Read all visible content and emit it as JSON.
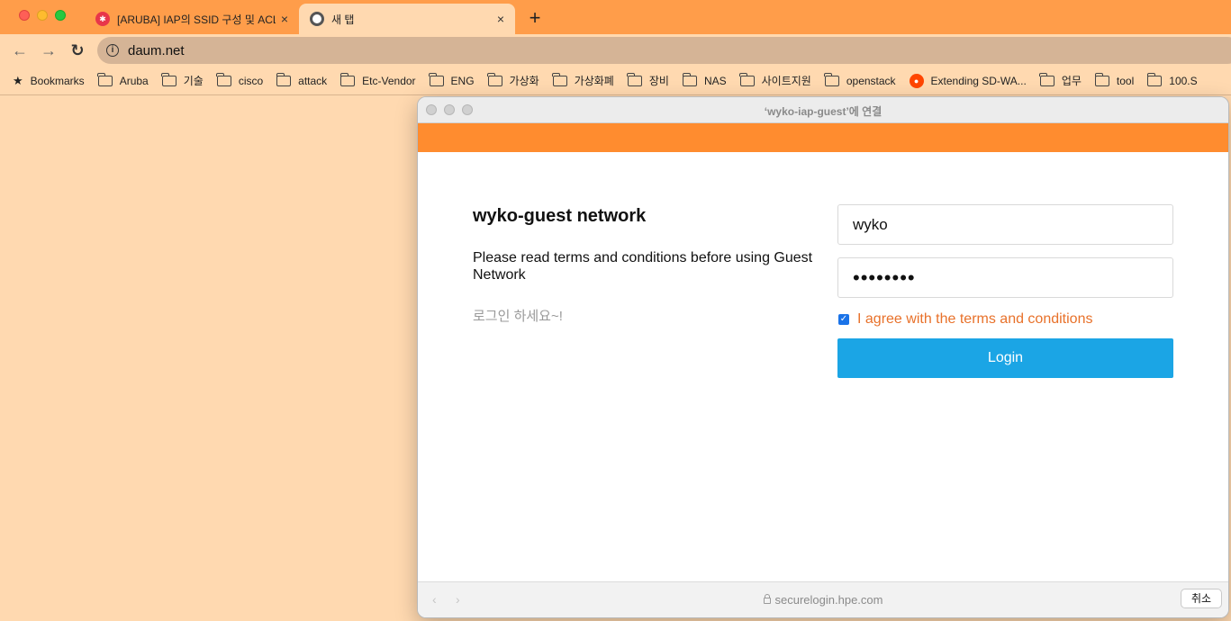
{
  "browser": {
    "tabs": [
      {
        "title": "[ARUBA] IAP의 SSID 구성 및 ACL",
        "close": "×"
      },
      {
        "title": "새 탭",
        "close": "×"
      }
    ],
    "new_tab": "+",
    "nav": {
      "back": "←",
      "forward": "→",
      "reload": "↻"
    },
    "address": {
      "info": "i",
      "url": "daum.net"
    },
    "bookmarks": [
      "Bookmarks",
      "Aruba",
      "기술",
      "cisco",
      "attack",
      "Etc-Vendor",
      "ENG",
      "가상화",
      "가상화폐",
      "장비",
      "NAS",
      "사이트지원",
      "openstack",
      "Extending SD-WA...",
      "업무",
      "tool",
      "100.S"
    ]
  },
  "portal": {
    "window_title": "‘wyko-iap-guest’에 연결",
    "heading": "wyko-guest network",
    "terms_text": "Please read terms and conditions before using Guest Network",
    "korean_note": "로그인 하세요~!",
    "username_value": "wyko",
    "password_value": "••••••••",
    "agree_checked": "✓",
    "agree_label": "I agree with the terms and conditions",
    "login_label": "Login",
    "footer": {
      "back": "‹",
      "forward": "›",
      "host": "securelogin.hpe.com",
      "cancel": "취소"
    }
  },
  "colors": {
    "tabstrip": "#ff9d4a",
    "page_bg": "#ffd9b0",
    "banner": "#ff8c2f",
    "login_button": "#1ba5e5",
    "agree_text": "#e8712a"
  }
}
